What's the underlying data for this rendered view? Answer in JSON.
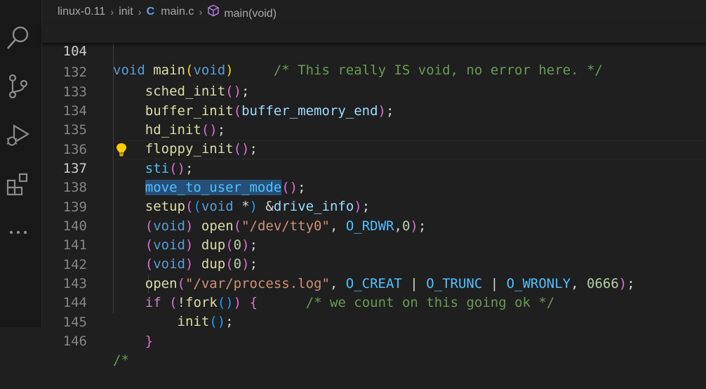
{
  "breadcrumb": {
    "folder": "linux-0.11",
    "subfolder": "init",
    "file_icon": "C",
    "file": "main.c",
    "symbol": "main(void)"
  },
  "activity_bar": {
    "icons": [
      "search-icon",
      "source-control-icon",
      "run-debug-icon",
      "extensions-icon",
      "more-icon"
    ]
  },
  "sticky_header": {
    "line_number": "104",
    "code": {
      "kw": "void",
      "fn": "main",
      "open": "(",
      "param": "void",
      "close": ")",
      "comment": "/* This really IS void, no error here. */"
    }
  },
  "lines": [
    {
      "number": "132",
      "tokens": [
        "sched_init",
        "()",
        ";"
      ]
    },
    {
      "number": "133",
      "tokens": [
        "buffer_init",
        "(",
        "buffer_memory_end",
        ")",
        ";"
      ]
    },
    {
      "number": "134",
      "tokens": [
        "hd_init",
        "()",
        ";"
      ]
    },
    {
      "number": "135",
      "tokens": [
        "floppy_init",
        "()",
        ";"
      ]
    },
    {
      "number": "136",
      "tokens": [
        "sti",
        "()",
        ";"
      ]
    },
    {
      "number": "137",
      "tokens": [
        "move_to_user_mode",
        "()",
        ";"
      ]
    },
    {
      "number": "138",
      "tokens": [
        "setup",
        "(",
        "(",
        "void",
        " *",
        ")",
        " &",
        "drive_info",
        ")",
        ";"
      ]
    },
    {
      "number": "139",
      "tokens": [
        "(",
        "void",
        ")",
        " ",
        "open",
        "(",
        "\"/dev/tty0\"",
        ", ",
        "O_RDWR",
        ",",
        "0",
        ")",
        ";"
      ]
    },
    {
      "number": "140",
      "tokens": [
        "(",
        "void",
        ")",
        " ",
        "dup",
        "(",
        "0",
        ")",
        ";"
      ]
    },
    {
      "number": "141",
      "tokens": [
        "(",
        "void",
        ")",
        " ",
        "dup",
        "(",
        "0",
        ")",
        ";"
      ]
    },
    {
      "number": "142",
      "tokens": [
        "open",
        "(",
        "\"/var/process.log\"",
        ", ",
        "O_CREAT",
        " | ",
        "O_TRUNC",
        " | ",
        "O_WRONLY",
        ", ",
        "0666",
        ")",
        ";"
      ]
    },
    {
      "number": "143",
      "tokens": [
        "if",
        " ",
        "(",
        "!",
        "fork",
        "()",
        ")",
        " ",
        "{",
        "      ",
        "/* we count on this going ok */"
      ]
    },
    {
      "number": "144",
      "tokens": [
        "init",
        "()",
        ";"
      ]
    },
    {
      "number": "145",
      "tokens": [
        "}"
      ]
    },
    {
      "number": "146",
      "tokens": [
        "/*"
      ]
    }
  ],
  "active_line": "137",
  "colors": {
    "background": "#1f1f1f",
    "keyword": "#569cd6",
    "function": "#dcdcaa",
    "variable": "#9cdcfe",
    "string": "#ce9178",
    "number": "#b5cea8",
    "comment": "#6a9955",
    "selection": "#264f78",
    "lightbulb": "#ffcc00"
  }
}
